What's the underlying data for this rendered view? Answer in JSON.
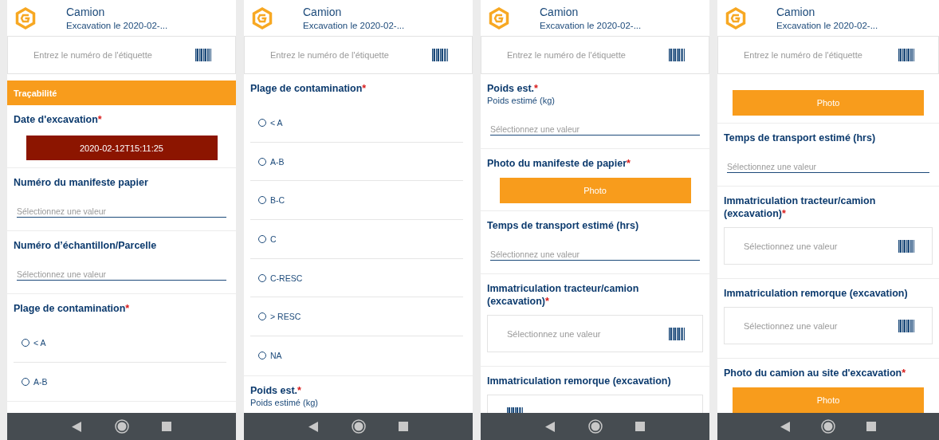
{
  "screens": [
    {
      "header": {
        "title": "Camion",
        "subtitle": "Excavation le 2020-02-..."
      },
      "tag_field": {
        "placeholder": "Entrez le numéro de l'étiquette"
      },
      "items": [
        {
          "kind": "section",
          "title": "Traçabilité"
        },
        {
          "kind": "date",
          "label": "Date d'excavation",
          "required_mark": "*",
          "value": "2020-02-12T15:11:25"
        },
        {
          "kind": "text",
          "label": "Numéro du manifeste papier",
          "placeholder": "Sélectionnez une valeur"
        },
        {
          "kind": "text",
          "label": "Numéro d’échantillon/Parcelle",
          "placeholder": "Sélectionnez une valeur"
        },
        {
          "kind": "radio",
          "label": "Plage de contamination",
          "required_mark": "*",
          "options": [
            {
              "label": "< A",
              "selected": false
            },
            {
              "label": "A-B",
              "selected": false
            }
          ]
        }
      ]
    },
    {
      "header": {
        "title": "Camion",
        "subtitle": "Excavation le 2020-02-..."
      },
      "tag_field": {
        "placeholder": "Entrez le numéro de l'étiquette"
      },
      "items": [
        {
          "kind": "radio",
          "label": "Plage de contamination",
          "required_mark": "*",
          "options": [
            {
              "label": "< A",
              "selected": false
            },
            {
              "label": "A-B",
              "selected": false
            },
            {
              "label": "B-C",
              "selected": false
            },
            {
              "label": "C",
              "selected": false
            },
            {
              "label": "C-RESC",
              "selected": false
            },
            {
              "label": "> RESC",
              "selected": false
            },
            {
              "label": "NA",
              "selected": false
            }
          ]
        },
        {
          "kind": "text",
          "label": "Poids est.",
          "required_mark": "*",
          "sublabel": "Poids estimé (kg)"
        }
      ]
    },
    {
      "header": {
        "title": "Camion",
        "subtitle": "Excavation le 2020-02-..."
      },
      "tag_field": {
        "placeholder": "Entrez le numéro de l'étiquette"
      },
      "items": [
        {
          "kind": "text",
          "label": "Poids est.",
          "required_mark": "*",
          "sublabel": "Poids estimé (kg)",
          "placeholder": "Sélectionnez une valeur"
        },
        {
          "kind": "photo",
          "label": "Photo du manifeste de papier",
          "required_mark": "*",
          "button": "Photo"
        },
        {
          "kind": "text",
          "label": "Temps de transport estimé (hrs)",
          "placeholder": "Sélectionnez une valeur"
        },
        {
          "kind": "scan",
          "label": "Immatriculation tracteur/camion (excavation)",
          "required_mark": "*",
          "placeholder": "Sélectionnez une valeur"
        },
        {
          "kind": "scan",
          "label": "Immatriculation remorque (excavation)"
        }
      ]
    },
    {
      "header": {
        "title": "Camion",
        "subtitle": "Excavation le 2020-02-..."
      },
      "tag_field": {
        "placeholder": "Entrez le numéro de l'étiquette"
      },
      "items": [
        {
          "kind": "photo",
          "button": "Photo"
        },
        {
          "kind": "text",
          "label": "Temps de transport estimé (hrs)",
          "placeholder": "Sélectionnez une valeur"
        },
        {
          "kind": "scan",
          "label": "Immatriculation tracteur/camion (excavation)",
          "required_mark": "*",
          "placeholder": "Sélectionnez une valeur"
        },
        {
          "kind": "scan",
          "label": "Immatriculation remorque (excavation)",
          "placeholder": "Sélectionnez une valeur"
        },
        {
          "kind": "photo",
          "label": "Photo du camion au site d'excavation",
          "required_mark": "*",
          "button": "Photo"
        }
      ]
    }
  ]
}
